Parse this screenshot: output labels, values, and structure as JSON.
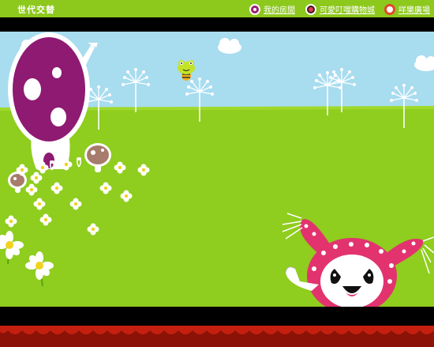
{
  "header": {
    "title": "世代交替"
  },
  "nav": [
    {
      "label": "我的房間",
      "icon": "room-icon",
      "color": "#9b1f72"
    },
    {
      "label": "可愛叮噹購物城",
      "icon": "shop-icon",
      "color": "#3b1a1a"
    },
    {
      "label": "咩樂廣場",
      "icon": "plaza-icon",
      "color": "#e04a2a"
    }
  ],
  "colors": {
    "sky": "#a8dcef",
    "grass": "#8fcd1e",
    "mushroom": "#8e1a72",
    "curtain": "#b81a0c",
    "header_bar": "#8dc81d",
    "creature": "#e2336f"
  }
}
